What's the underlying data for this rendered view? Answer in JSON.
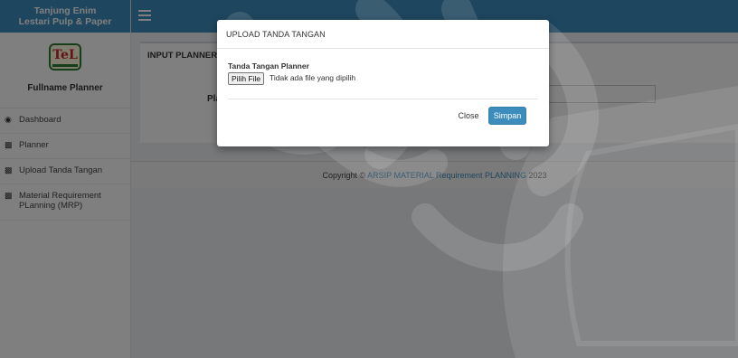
{
  "app": {
    "brand_line1": "Tanjung Enim",
    "brand_line2": "Lestari Pulp & Paper",
    "user_name": "Fullname Planner"
  },
  "sidebar": {
    "items": [
      {
        "label": "Dashboard",
        "icon": "dashboard-icon"
      },
      {
        "label": "Planner",
        "icon": "book-icon"
      },
      {
        "label": "Upload Tanda Tangan",
        "icon": "book-icon"
      },
      {
        "label": "Material Requirement PLanning (MRP)",
        "icon": "book-icon"
      }
    ]
  },
  "main": {
    "panel_title": "INPUT PLANNER",
    "field_label_partial": "Pla"
  },
  "footer": {
    "prefix": "Copyright © ",
    "brand": "ARSIP MATERIAL Requirement PLANNING",
    "year": " 2023"
  },
  "modal": {
    "title": "UPLOAD TANDA TANGAN",
    "field_label": "Tanda Tangan Planner",
    "file_button": "Pilih File",
    "file_status": "Tidak ada file yang dipilih",
    "close_label": "Close",
    "save_label": "Simpan"
  },
  "colors": {
    "primary": "#3c8dbc",
    "overlay": "rgba(0,0,0,0.5)"
  }
}
